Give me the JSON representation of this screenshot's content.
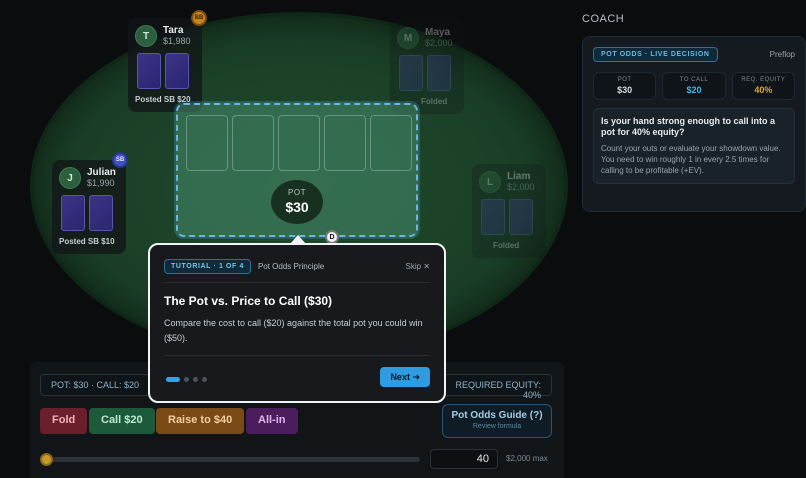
{
  "seats": {
    "tara": {
      "initial": "T",
      "name": "Tara",
      "stack": "$1,980",
      "posted": "Posted SB $20",
      "badge": "BB"
    },
    "maya": {
      "initial": "M",
      "name": "Maya",
      "stack": "$2,000",
      "status": "Folded"
    },
    "julian": {
      "initial": "J",
      "name": "Julian",
      "stack": "$1,990",
      "posted": "Posted SB $10",
      "badge": "SB"
    },
    "liam": {
      "initial": "L",
      "name": "Liam",
      "stack": "$2,000",
      "status": "Folded"
    }
  },
  "board": {
    "pot_label": "POT",
    "pot_value": "$30",
    "dealer": "D"
  },
  "coach": {
    "heading": "COACH",
    "pill": "POT ODDS · LIVE DECISION",
    "street": "Preflop",
    "stats": [
      {
        "key": "POT",
        "value": "$30",
        "color": "#d7dde2"
      },
      {
        "key": "TO CALL",
        "value": "$20",
        "color": "#4fb0ea"
      },
      {
        "key": "REQ. EQUITY",
        "value": "40%",
        "color": "#d9a640"
      }
    ],
    "question": "Is your hand strong enough to call into a pot for 40% equity?",
    "explanation": "Count your outs or evaluate your showdown value. You need to win roughly 1 in every 2.5 times for calling to be profitable (+EV)."
  },
  "controls": {
    "pot_call": "POT: $30 · CALL: $20",
    "required_equity": "REQUIRED EQUITY: 40%",
    "fold": "Fold",
    "call": "Call $20",
    "raise": "Raise to $40",
    "allin": "All-in",
    "guide_title": "Pot Odds Guide (?)",
    "guide_sub": "Review formula",
    "amount": "40",
    "max": "$2,000 max",
    "slider_fraction": 0.0
  },
  "tutorial": {
    "step": "TUTORIAL · 1 OF 4",
    "topic": "Pot Odds Principle",
    "skip": "Skip ✕",
    "title": "The Pot vs. Price to Call ($30)",
    "body": "Compare the cost to call ($20) against the total pot you could win ($50).",
    "next": "Next ➜",
    "total_steps": 4,
    "current_step": 1
  }
}
